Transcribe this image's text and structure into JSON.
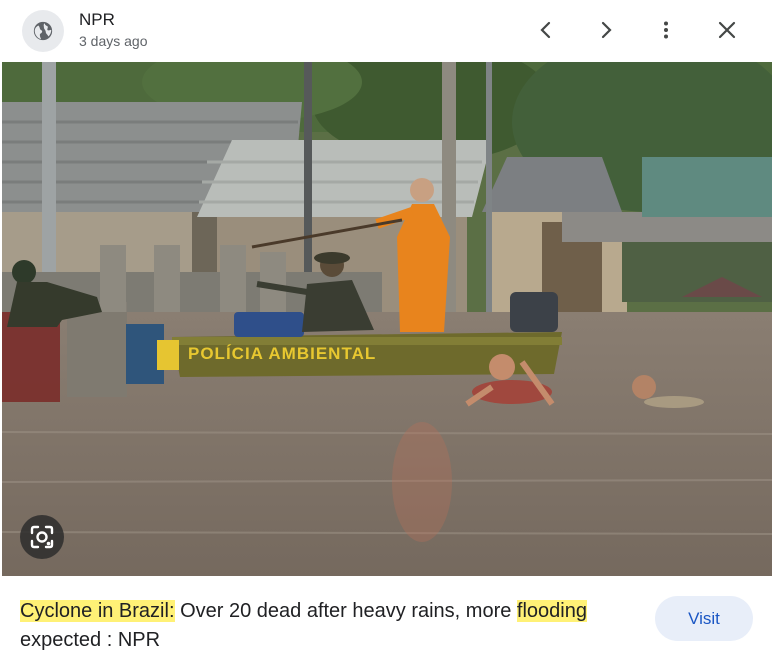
{
  "header": {
    "source_name": "NPR",
    "time_ago": "3 days ago",
    "source_icon": "globe-icon",
    "prev_icon": "chevron-left-icon",
    "next_icon": "chevron-right-icon",
    "more_icon": "more-vert-icon",
    "close_icon": "close-icon"
  },
  "image": {
    "boat_text": "POLÍCIA AMBIENTAL",
    "lens_icon": "lens-icon"
  },
  "caption": {
    "highlight1": "Cyclone in Brazil:",
    "text1": " Over 20 dead after heavy rains, more ",
    "highlight2": "flooding",
    "text2": " expected : NPR",
    "highlight_color": "#fff176"
  },
  "visit": {
    "label": "Visit"
  }
}
